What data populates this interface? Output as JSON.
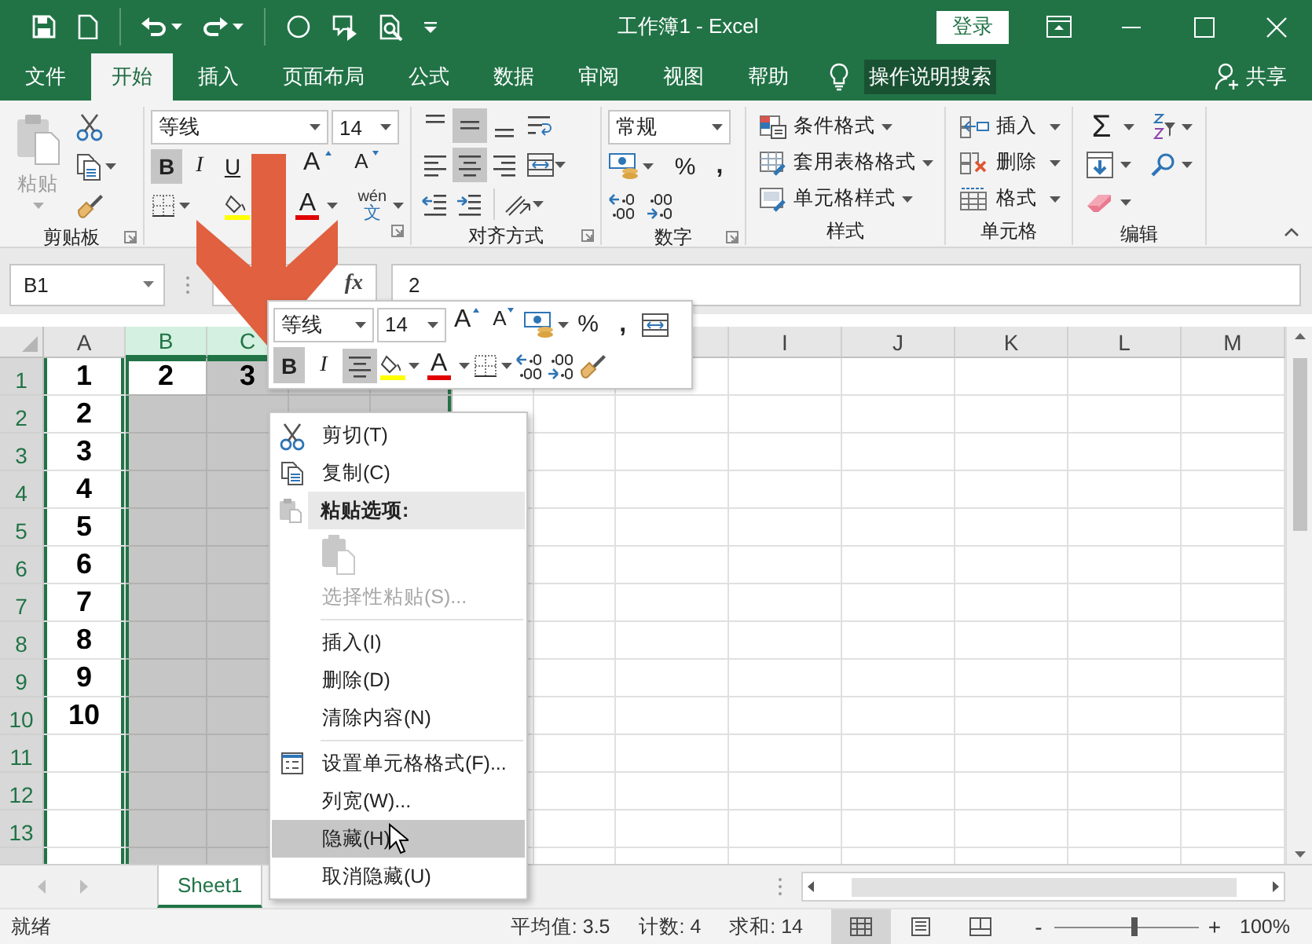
{
  "window": {
    "title": "工作簿1 - Excel",
    "sign_in": "登录"
  },
  "menu_tabs": [
    {
      "label": "文件",
      "selected": false
    },
    {
      "label": "开始",
      "selected": true
    },
    {
      "label": "插入",
      "selected": false
    },
    {
      "label": "页面布局",
      "selected": false
    },
    {
      "label": "公式",
      "selected": false
    },
    {
      "label": "数据",
      "selected": false
    },
    {
      "label": "审阅",
      "selected": false
    },
    {
      "label": "视图",
      "selected": false
    },
    {
      "label": "帮助",
      "selected": false
    }
  ],
  "tell_me": "操作说明搜索",
  "share": "共享",
  "ribbon": {
    "clipboard": {
      "paste": {
        "label": "粘贴",
        "disabled": true
      },
      "label": "剪贴板"
    },
    "font": {
      "font_name": "等线",
      "font_size": "14",
      "bold": {
        "text": "B",
        "on": true
      },
      "italic": {
        "text": "I",
        "on": false
      },
      "underline": {
        "text": "U",
        "on": false
      },
      "grow": "A",
      "shrink": "A",
      "font_color": "A",
      "phonetic": {
        "top": "wén",
        "bottom": "文"
      }
    },
    "alignment": {
      "top_on": false,
      "middle_on": true,
      "bottom_on": false,
      "left_on": false,
      "center_on": true,
      "right_on": false,
      "label": "对齐方式"
    },
    "number": {
      "format": "常规",
      "percent": "%",
      "comma": ",",
      "label": "数字"
    },
    "styles": {
      "items": [
        "条件格式",
        "套用表格格式",
        "单元格样式"
      ],
      "label": "样式"
    },
    "cells": {
      "items": [
        "插入",
        "删除",
        "格式"
      ],
      "label": "单元格"
    },
    "editing": {
      "sum": "Σ",
      "label": "编辑"
    }
  },
  "formula_bar": {
    "name_box": "B1",
    "fx": "fx",
    "value": "2"
  },
  "grid": {
    "columns": [
      {
        "label": "A",
        "selected": false
      },
      {
        "label": "B",
        "selected": true
      },
      {
        "label": "C",
        "selected": true
      },
      {
        "selected": true
      },
      {
        "selected": true
      },
      {
        "selected": false
      },
      {
        "selected": false
      },
      {
        "selected": false
      },
      {
        "label": "I",
        "selected": false
      },
      {
        "label": "J",
        "selected": false
      },
      {
        "label": "K",
        "selected": false
      },
      {
        "label": "L",
        "selected": false
      },
      {
        "label": "M",
        "selected": false
      }
    ],
    "rows": [
      {
        "label": "1",
        "cells": [
          {
            "text": "1",
            "active": false
          },
          {
            "text": "2",
            "active": true
          },
          {
            "text": "3",
            "active": false
          }
        ]
      },
      {
        "label": "2",
        "cells": [
          {
            "text": "2",
            "active": false
          }
        ]
      },
      {
        "label": "3",
        "cells": [
          {
            "text": "3",
            "active": false
          }
        ]
      },
      {
        "label": "4",
        "cells": [
          {
            "text": "4",
            "active": false
          }
        ]
      },
      {
        "label": "5",
        "cells": [
          {
            "text": "5",
            "active": false
          }
        ]
      },
      {
        "label": "6",
        "cells": [
          {
            "text": "6",
            "active": false
          }
        ]
      },
      {
        "label": "7",
        "cells": [
          {
            "text": "7",
            "active": false
          }
        ]
      },
      {
        "label": "8",
        "cells": [
          {
            "text": "8",
            "active": false
          }
        ]
      },
      {
        "label": "9",
        "cells": [
          {
            "text": "9",
            "active": false
          }
        ]
      },
      {
        "label": "10",
        "cells": [
          {
            "text": "10",
            "active": false
          }
        ]
      },
      {
        "label": "11"
      },
      {
        "label": "12"
      },
      {
        "label": "13"
      }
    ]
  },
  "mini_toolbar": {
    "font_name": "等线",
    "font_size": "14",
    "grow": "A",
    "shrink": "A",
    "percent": "%",
    "comma": ",",
    "bold": {
      "text": "B",
      "on": true
    },
    "italic": {
      "text": "I",
      "on": false
    },
    "center_on": true,
    "font_color": "A"
  },
  "context_menu": [
    {
      "kind": "icon-command",
      "text": "剪切(T)",
      "disabled": false,
      "selected": false
    },
    {
      "kind": "icon-command",
      "text": "复制(C)",
      "disabled": false,
      "selected": false
    },
    {
      "kind": "header",
      "text": "粘贴选项:"
    },
    {
      "kind": "paste-option",
      "disabled": true
    },
    {
      "kind": "command",
      "text": "选择性粘贴(S)...",
      "disabled": true,
      "selected": false
    },
    {
      "kind": "separator"
    },
    {
      "kind": "command",
      "text": "插入(I)",
      "disabled": false,
      "selected": false
    },
    {
      "kind": "command",
      "text": "删除(D)",
      "disabled": false,
      "selected": false
    },
    {
      "kind": "command",
      "text": "清除内容(N)",
      "disabled": false,
      "selected": false
    },
    {
      "kind": "separator"
    },
    {
      "kind": "icon-command",
      "text": "设置单元格格式(F)...",
      "disabled": false,
      "selected": false
    },
    {
      "kind": "command",
      "text": "列宽(W)...",
      "disabled": false,
      "selected": false
    },
    {
      "kind": "command",
      "text": "隐藏(H)",
      "disabled": false,
      "selected": true
    },
    {
      "kind": "command",
      "text": "取消隐藏(U)",
      "disabled": false,
      "selected": false
    }
  ],
  "sheet_tabs": [
    {
      "label": "Sheet1",
      "selected": true
    }
  ],
  "status_bar": {
    "status": "就绪",
    "average": "平均值: 3.5",
    "count": "计数: 4",
    "sum": "求和: 14",
    "views": [
      {
        "selected": true
      },
      {
        "selected": false
      },
      {
        "selected": false
      }
    ],
    "zoom_out": "-",
    "zoom_in": "+",
    "zoom": {
      "level": 0.55
    },
    "zoom_text": "100%"
  }
}
